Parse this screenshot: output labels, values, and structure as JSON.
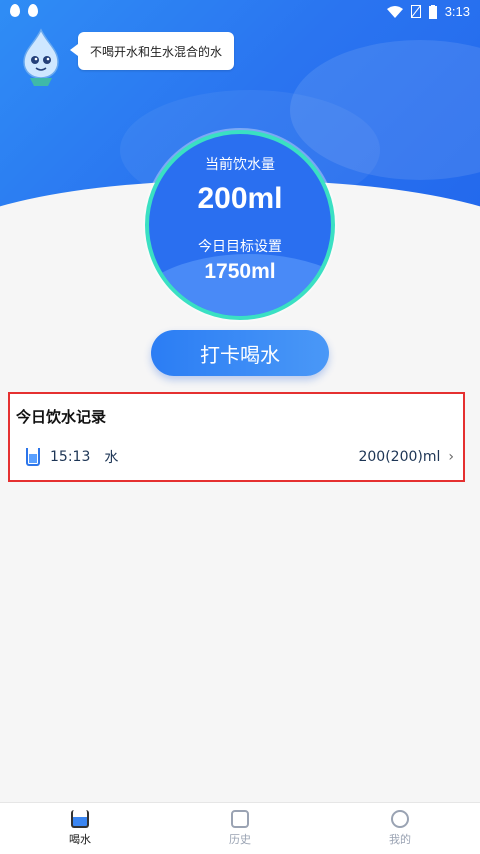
{
  "status_bar": {
    "time": "3:13"
  },
  "mascot": {
    "bubble_text": "不喝开水和生水混合的水"
  },
  "ring": {
    "current_label": "当前饮水量",
    "current_value": "200ml",
    "target_label": "今日目标设置",
    "target_value": "1750ml"
  },
  "punch_button": {
    "label": "打卡喝水"
  },
  "records": {
    "title": "今日饮水记录",
    "items": [
      {
        "time": "15:13",
        "name": "水",
        "amount": "200(200)ml"
      }
    ]
  },
  "bottom_nav": {
    "items": [
      {
        "label": "喝水",
        "icon": "cup-icon",
        "active": true
      },
      {
        "label": "历史",
        "icon": "calendar-icon",
        "active": false
      },
      {
        "label": "我的",
        "icon": "user-icon",
        "active": false
      }
    ]
  },
  "colors": {
    "primary": "#2a6ff0",
    "ring_border": "#3ae0c3",
    "highlight": "#e53030"
  }
}
